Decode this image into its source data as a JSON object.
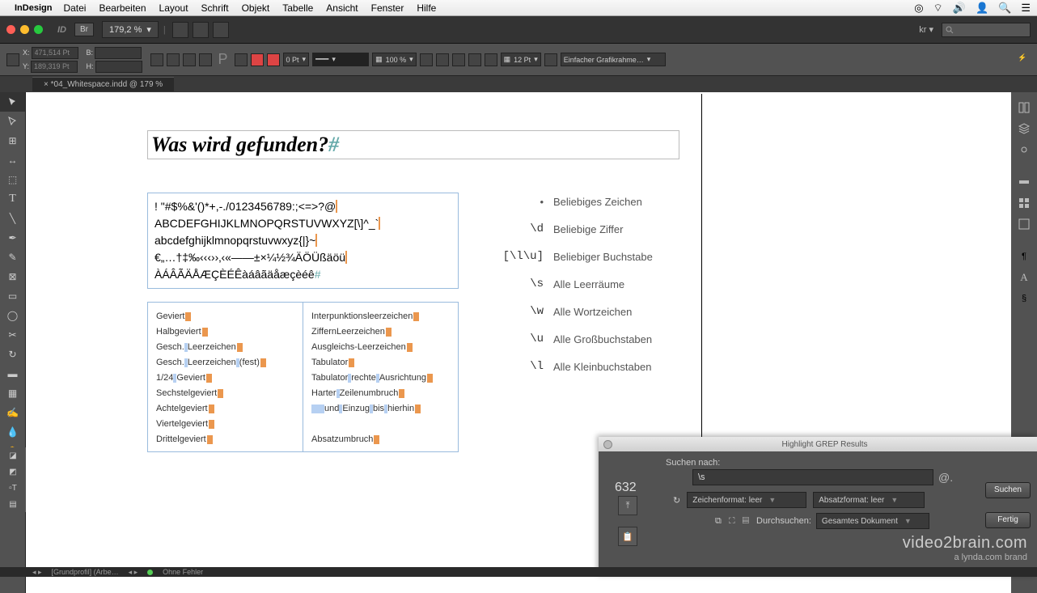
{
  "menubar": {
    "app": "InDesign",
    "items": [
      "Datei",
      "Bearbeiten",
      "Layout",
      "Schrift",
      "Objekt",
      "Tabelle",
      "Ansicht",
      "Fenster",
      "Hilfe"
    ]
  },
  "appbar": {
    "zoom": "179,2 %",
    "layout": "kr"
  },
  "control": {
    "x": "471,514 Pt",
    "y": "189,319 Pt",
    "stroke": "0 Pt",
    "opacity": "100 %",
    "gap": "12 Pt",
    "frame_fit": "Einfacher Grafikrahme…"
  },
  "tab": "*04_Whitespace.indd @ 179 %",
  "title": "Was wird gefunden?",
  "charlines": {
    "l1": "! \"#$%&'()*+,-./0123456789:;<=>?@",
    "l2": "ABCDEFGHIJKLMNOPQRSTUVWXYZ[\\]^_`",
    "l3": "abcdefghijklmnopqrstuvwxyz{|}~",
    "l4": "€„…†‡‰‹‹‹››‚‹«—―±×¼½¾ÄÖÜßäöü",
    "l5": "ÀÁÂÃÄÅÆÇÈÉÊàáâãäåæçèéê"
  },
  "spaces": {
    "left": [
      "Geviert",
      "Halbgeviert",
      "Gesch. Leerzeichen",
      "Gesch. Leerzeichen (fest)",
      "1/24 Geviert",
      "Sechstelgeviert",
      "Achtelgeviert",
      "Viertelgeviert",
      "Drittelgeviert"
    ],
    "right": [
      "Interpunktionsleerzeichen",
      "ZiffernLeerzeichen",
      "Ausgleichs-Leerzeichen",
      "Tabulator",
      "Tabulator rechte Ausrichtung",
      "Harter Zeilenumbruch",
      "    und Einzug bis hierhin",
      "",
      "Absatzumbruch"
    ]
  },
  "greps": [
    {
      "code": ".",
      "label": "Beliebiges Zeichen",
      "dot": true
    },
    {
      "code": "\\d",
      "label": "Beliebige Ziffer"
    },
    {
      "code": "[\\l\\u]",
      "label": "Beliebiger Buchstabe"
    },
    {
      "code": "\\s",
      "label": "Alle Leerräume"
    },
    {
      "code": "\\w",
      "label": "Alle Wortzeichen"
    },
    {
      "code": "\\u",
      "label": "Alle Großbuchstaben"
    },
    {
      "code": "\\l",
      "label": "Alle Kleinbuchstaben"
    }
  ],
  "panel": {
    "title": "Highlight GREP Results",
    "count": "632",
    "search_label": "Suchen nach:",
    "search_value": "\\s",
    "char_fmt": "Zeichenformat: leer",
    "para_fmt": "Absatzformat: leer",
    "scope_label": "Durchsuchen:",
    "scope_value": "Gesamtes Dokument",
    "btn_search": "Suchen",
    "btn_done": "Fertig"
  },
  "brand": {
    "main": "video2brain.com",
    "sub": "a lynda.com brand"
  },
  "bottom": {
    "profile": "[Grundprofil] (Arbe…",
    "errors": "Ohne Fehler"
  }
}
